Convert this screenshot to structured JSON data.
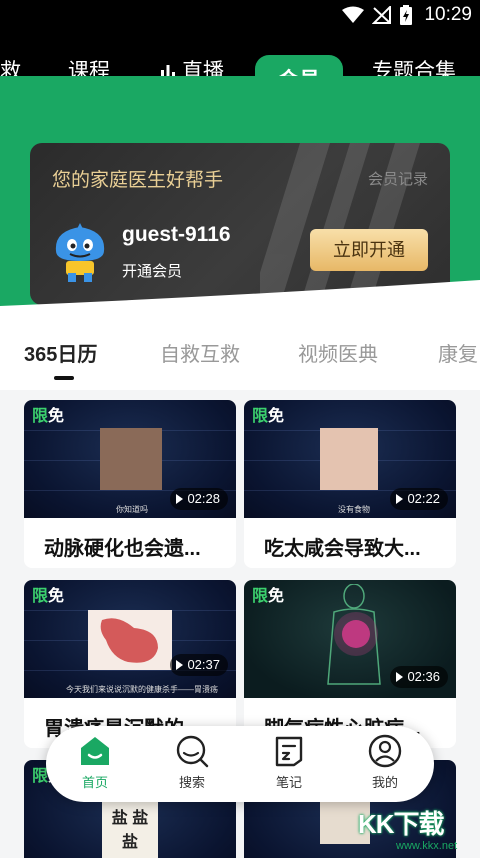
{
  "status_bar": {
    "time": "10:29"
  },
  "top_tabs": [
    {
      "label": "救"
    },
    {
      "label": "课程"
    },
    {
      "label": "直播"
    },
    {
      "label": "会员",
      "active": true
    },
    {
      "label": "专题合集"
    }
  ],
  "member_card": {
    "title": "您的家庭医生好帮手",
    "record_link": "会员记录",
    "username": "guest-9116",
    "subtitle": "开通会员",
    "cta": "立即开通"
  },
  "sub_tabs": [
    {
      "label": "365日历",
      "active": true
    },
    {
      "label": "自救互救"
    },
    {
      "label": "视频医典"
    },
    {
      "label": "康复"
    }
  ],
  "videos": [
    {
      "badge_a": "限",
      "badge_b": "免",
      "duration": "02:28",
      "title": "动脉硬化也会遗...",
      "caption": "你知道吗"
    },
    {
      "badge_a": "限",
      "badge_b": "免",
      "duration": "02:22",
      "title": "吃太咸会导致大...",
      "caption": "没有食物"
    },
    {
      "badge_a": "限",
      "badge_b": "免",
      "duration": "02:37",
      "title": "胃溃疡是沉默的...",
      "caption": "今天我们来说说沉默的健康杀手——胃溃疡"
    },
    {
      "badge_a": "限",
      "badge_b": "免",
      "duration": "02:36",
      "title": "脚气病性心脏病...",
      "caption": ""
    },
    {
      "badge_a": "限",
      "badge_b": "免",
      "duration": "",
      "title": "",
      "caption": "盐 盐盐"
    },
    {
      "badge_a": "",
      "badge_b": "",
      "duration": "",
      "title": "",
      "caption": ""
    }
  ],
  "bottom_nav": [
    {
      "label": "首页",
      "active": true,
      "icon": "home-icon"
    },
    {
      "label": "搜索",
      "icon": "search-icon"
    },
    {
      "label": "笔记",
      "icon": "note-icon"
    },
    {
      "label": "我的",
      "icon": "profile-icon"
    }
  ],
  "watermark": {
    "text": "KK下载",
    "url": "www.kkx.net"
  },
  "colors": {
    "brand_green": "#1aa863",
    "gold": "#e9cf95"
  }
}
